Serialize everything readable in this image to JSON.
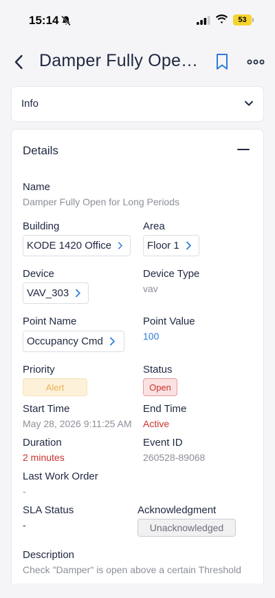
{
  "status_bar": {
    "time": "15:14",
    "battery": "53",
    "icons": [
      "bell-slash-icon",
      "signal-icon",
      "wifi-icon",
      "battery-icon"
    ]
  },
  "header": {
    "title": "Damper Fully Open...",
    "icons": [
      "chevron-left-icon",
      "bookmark-icon",
      "more-icon"
    ]
  },
  "info_section": {
    "title": "Info"
  },
  "details": {
    "title": "Details",
    "name_label": "Name",
    "name_value": "Damper Fully Open for Long Periods",
    "building_label": "Building",
    "building_value": "KODE 1420 Office",
    "area_label": "Area",
    "area_value": "Floor 1",
    "device_label": "Device",
    "device_value": "VAV_303",
    "device_type_label": "Device Type",
    "device_type_value": "vav",
    "point_name_label": "Point Name",
    "point_name_value": "Occupancy Cmd",
    "point_value_label": "Point Value",
    "point_value_value": "100",
    "priority_label": "Priority",
    "priority_value": "Alert",
    "status_label": "Status",
    "status_value": "Open",
    "start_time_label": "Start Time",
    "start_time_value": "May 28, 2026 9:11:25 AM",
    "end_time_label": "End Time",
    "end_time_value": "Active",
    "duration_label": "Duration",
    "duration_value": "2 minutes",
    "event_id_label": "Event ID",
    "event_id_value": "260528-89068",
    "last_work_order_label": "Last Work Order",
    "last_work_order_value": "-",
    "sla_status_label": "SLA Status",
    "sla_status_value": "-",
    "acknowledgment_label": "Acknowledgment",
    "acknowledgment_value": "Unacknowledged",
    "description_label": "Description",
    "description_value": "Check \"Damper\" is open above a certain Threshold"
  },
  "colors": {
    "accent": "#2b7bd6",
    "danger": "#c9302c",
    "alert": "#e8b453",
    "battery": "#f6d32d"
  }
}
